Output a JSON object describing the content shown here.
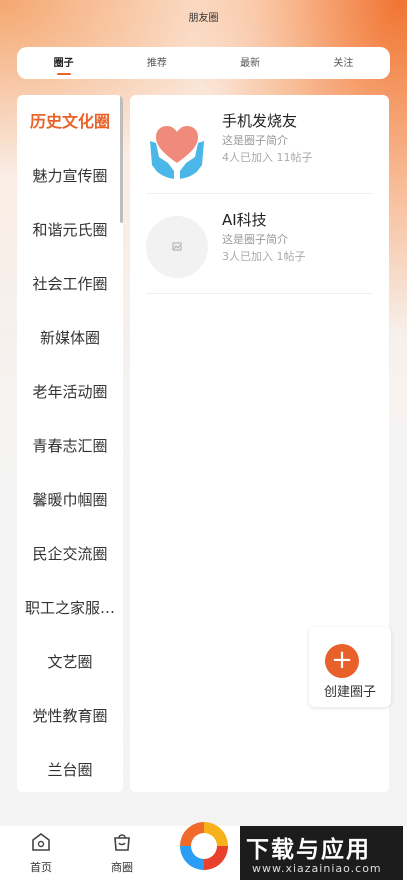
{
  "header": {
    "title": "朋友圈"
  },
  "tabs": [
    {
      "label": "圈子",
      "active": true
    },
    {
      "label": "推荐",
      "active": false
    },
    {
      "label": "最新",
      "active": false
    },
    {
      "label": "关注",
      "active": false
    }
  ],
  "sidebar": {
    "items": [
      {
        "label": "历史文化圈",
        "active": true
      },
      {
        "label": "魅力宣传圈"
      },
      {
        "label": "和谐元氏圈"
      },
      {
        "label": "社会工作圈"
      },
      {
        "label": "新媒体圈"
      },
      {
        "label": "老年活动圈"
      },
      {
        "label": "青春志汇圈"
      },
      {
        "label": "馨暖巾帼圈"
      },
      {
        "label": "民企交流圈"
      },
      {
        "label": "职工之家服…"
      },
      {
        "label": "文艺圈"
      },
      {
        "label": "党性教育圈"
      },
      {
        "label": "兰台圈"
      }
    ]
  },
  "circles": [
    {
      "name": "手机发烧友",
      "desc": "这是圈子简介",
      "stats": "4人已加入 11帖子",
      "icon": "heart-hands-icon"
    },
    {
      "name": "AI科技",
      "desc": "这是圈子简介",
      "stats": "3人已加入 1帖子",
      "icon": "image-placeholder-icon"
    }
  ],
  "create": {
    "label": "创建圈子"
  },
  "bottom_nav": [
    {
      "label": "首页",
      "icon": "home-icon"
    },
    {
      "label": "商圈",
      "icon": "bag-icon"
    }
  ],
  "watermark": {
    "text": "下载与应用",
    "url": "www.xiazainiao.com"
  },
  "colors": {
    "accent": "#e8622a"
  }
}
